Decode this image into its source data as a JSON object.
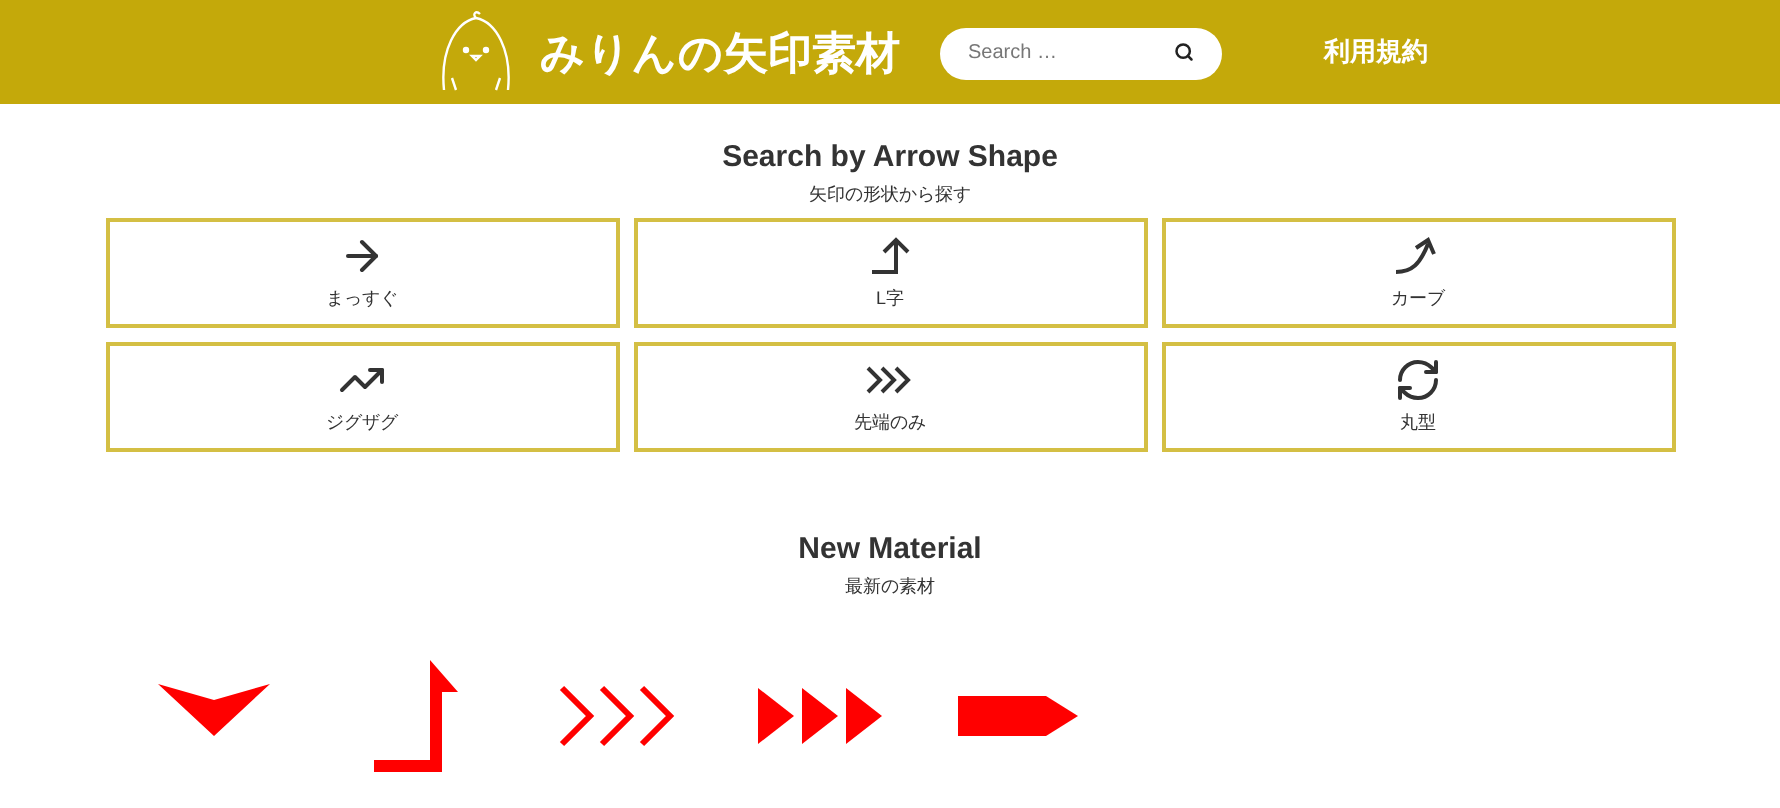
{
  "header": {
    "site_title": "みりんの矢印素材",
    "search": {
      "placeholder": "Search …"
    },
    "nav": [
      "利用規約"
    ]
  },
  "shape_section": {
    "title": "Search by Arrow Shape",
    "subtitle": "矢印の形状から探す",
    "cards": [
      {
        "kind": "straight",
        "label": "まっすぐ"
      },
      {
        "kind": "l",
        "label": "L字"
      },
      {
        "kind": "curve",
        "label": "カーブ"
      },
      {
        "kind": "zigzag",
        "label": "ジグザグ"
      },
      {
        "kind": "tips",
        "label": "先端のみ"
      },
      {
        "kind": "round",
        "label": "丸型"
      }
    ]
  },
  "new_section": {
    "title": "New Material",
    "subtitle": "最新の素材",
    "materials": [
      {
        "kind": "chevron-down"
      },
      {
        "kind": "l-up"
      },
      {
        "kind": "chevrons"
      },
      {
        "kind": "triangles"
      },
      {
        "kind": "pentagon"
      }
    ]
  }
}
